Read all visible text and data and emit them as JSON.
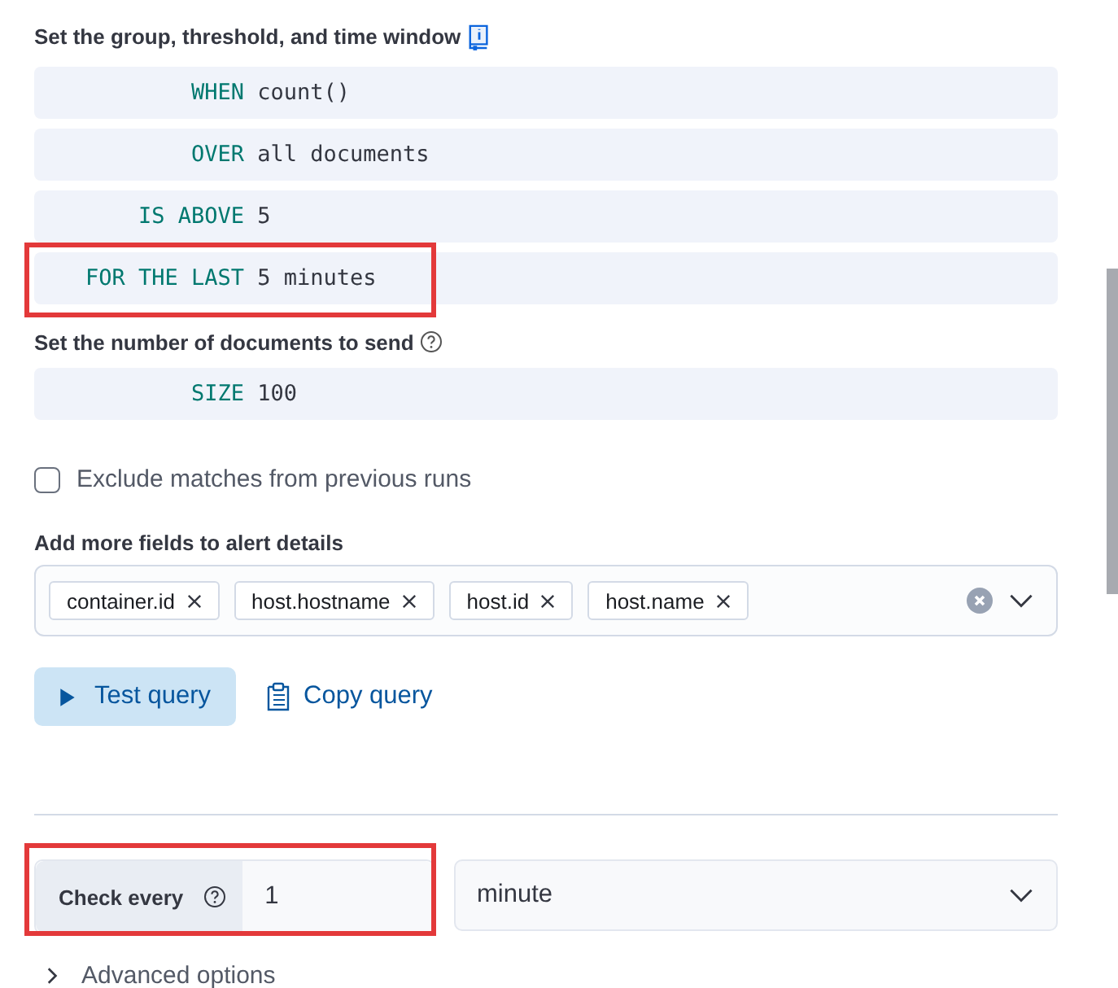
{
  "threshold_section": {
    "label": "Set the group, threshold, and time window",
    "expressions": [
      {
        "keyword": "WHEN",
        "value": "count()",
        "highlighted": false
      },
      {
        "keyword": "OVER",
        "value": "all documents",
        "highlighted": false
      },
      {
        "keyword": "IS ABOVE",
        "value": "5",
        "highlighted": false
      },
      {
        "keyword": "FOR THE LAST",
        "value": "5 minutes",
        "highlighted": true
      }
    ]
  },
  "size_section": {
    "label": "Set the number of documents to send",
    "keyword": "SIZE",
    "value": "100"
  },
  "exclude_checkbox": {
    "label": "Exclude matches from previous runs",
    "checked": false
  },
  "fields_section": {
    "label": "Add more fields to alert details",
    "chips": [
      "container.id",
      "host.hostname",
      "host.id",
      "host.name"
    ]
  },
  "buttons": [
    {
      "kind": "primary",
      "label": "Test query"
    },
    {
      "kind": "link",
      "label": "Copy query"
    }
  ],
  "schedule": {
    "label": "Check every",
    "value": "1",
    "unit": "minute",
    "highlighted": true
  },
  "advanced": {
    "label": "Advanced options",
    "expanded": false
  }
}
